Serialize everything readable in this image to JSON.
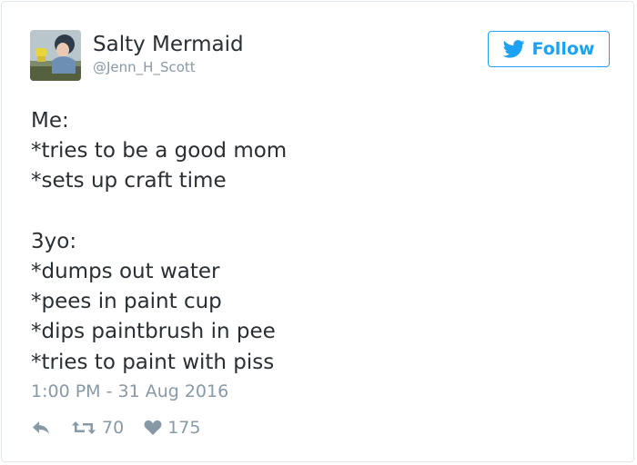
{
  "author": {
    "display_name": "Salty Mermaid",
    "handle": "@Jenn_H_Scott",
    "avatar_icon": "user-avatar"
  },
  "follow_button": {
    "label": "Follow",
    "icon": "twitter-bird-icon",
    "color": "#1da1f2"
  },
  "tweet": {
    "lines": [
      "Me:",
      "*tries to be a good mom",
      "*sets up craft time",
      "",
      "3yo:",
      "*dumps out water",
      "*pees in paint cup",
      "*dips paintbrush in pee",
      "*tries to paint with piss"
    ],
    "timestamp": "1:00 PM - 31 Aug 2016"
  },
  "actions": {
    "reply_icon": "reply-icon",
    "retweet_icon": "retweet-icon",
    "retweet_count": "70",
    "like_icon": "heart-icon",
    "like_count": "175"
  },
  "colors": {
    "text": "#292f33",
    "muted": "#8899a6",
    "border": "#e1e8ed"
  }
}
